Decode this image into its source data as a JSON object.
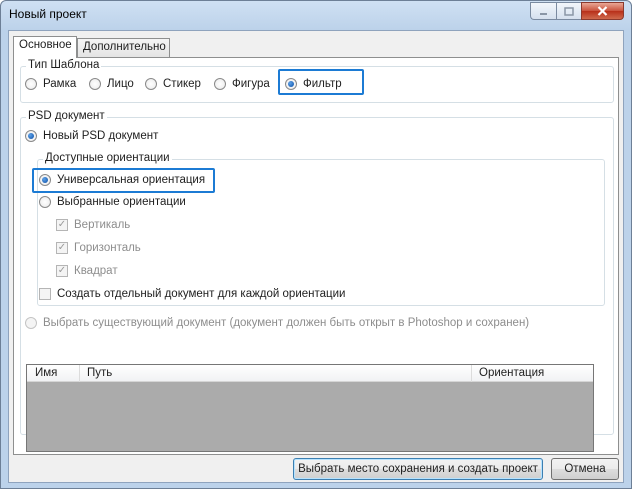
{
  "window": {
    "title": "Новый проект"
  },
  "tabs": [
    {
      "label": "Основное",
      "active": true
    },
    {
      "label": "Дополнительно",
      "active": false
    }
  ],
  "template_type": {
    "legend": "Тип Шаблона",
    "options": [
      {
        "label": "Рамка",
        "checked": false
      },
      {
        "label": "Лицо",
        "checked": false
      },
      {
        "label": "Стикер",
        "checked": false
      },
      {
        "label": "Фигура",
        "checked": false
      },
      {
        "label": "Фильтр",
        "checked": true
      }
    ]
  },
  "psd": {
    "legend": "PSD документ",
    "new_doc_label": "Новый PSD документ",
    "orientations": {
      "legend": "Доступные ориентации",
      "universal_label": "Универсальная ориентация",
      "selected_label": "Выбранные ориентации",
      "checks": [
        {
          "label": "Вертикаль",
          "checked": true
        },
        {
          "label": "Горизонталь",
          "checked": true
        },
        {
          "label": "Квадрат",
          "checked": true
        }
      ]
    },
    "separate_doc_label": "Создать отдельный документ для каждой ориентации",
    "existing_doc_label": "Выбрать существующий документ (документ должен быть открыт в Photoshop и сохранен)",
    "columns": [
      "Имя",
      "Путь",
      "Ориентация"
    ]
  },
  "buttons": {
    "save_label": "Выбрать место сохранения и создать проект",
    "cancel_label": "Отмена"
  },
  "colors": {
    "highlight": "#1c7bd4",
    "list_background": "#ababab"
  }
}
